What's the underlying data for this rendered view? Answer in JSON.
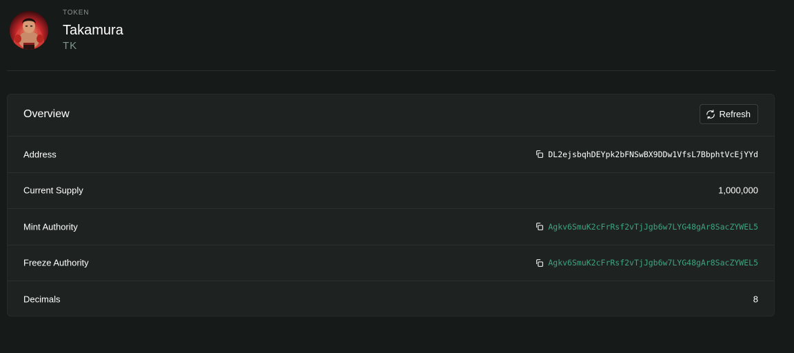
{
  "colors": {
    "background": "#161a19",
    "card": "#1e2322",
    "link": "#3fa37f",
    "symbol": "#7d988c"
  },
  "token": {
    "kicker": "TOKEN",
    "name": "Takamura",
    "symbol": "TK",
    "avatar_icon": "avatar-image"
  },
  "overview": {
    "title": "Overview",
    "refresh_label": "Refresh",
    "refresh_icon": "refresh-icon",
    "rows": [
      {
        "label": "Address",
        "value": "DL2ejsbqhDEYpk2bFNSwBX9DDw1VfsL7BbphtVcEjYYd",
        "copyable": true,
        "link": false
      },
      {
        "label": "Current Supply",
        "value": "1,000,000",
        "copyable": false,
        "link": false
      },
      {
        "label": "Mint Authority",
        "value": "Agkv6SmuK2cFrRsf2vTjJgb6w7LYG48gAr8SacZYWEL5",
        "copyable": true,
        "link": true
      },
      {
        "label": "Freeze Authority",
        "value": "Agkv6SmuK2cFrRsf2vTjJgb6w7LYG48gAr8SacZYWEL5",
        "copyable": true,
        "link": true
      },
      {
        "label": "Decimals",
        "value": "8",
        "copyable": false,
        "link": false
      }
    ]
  }
}
